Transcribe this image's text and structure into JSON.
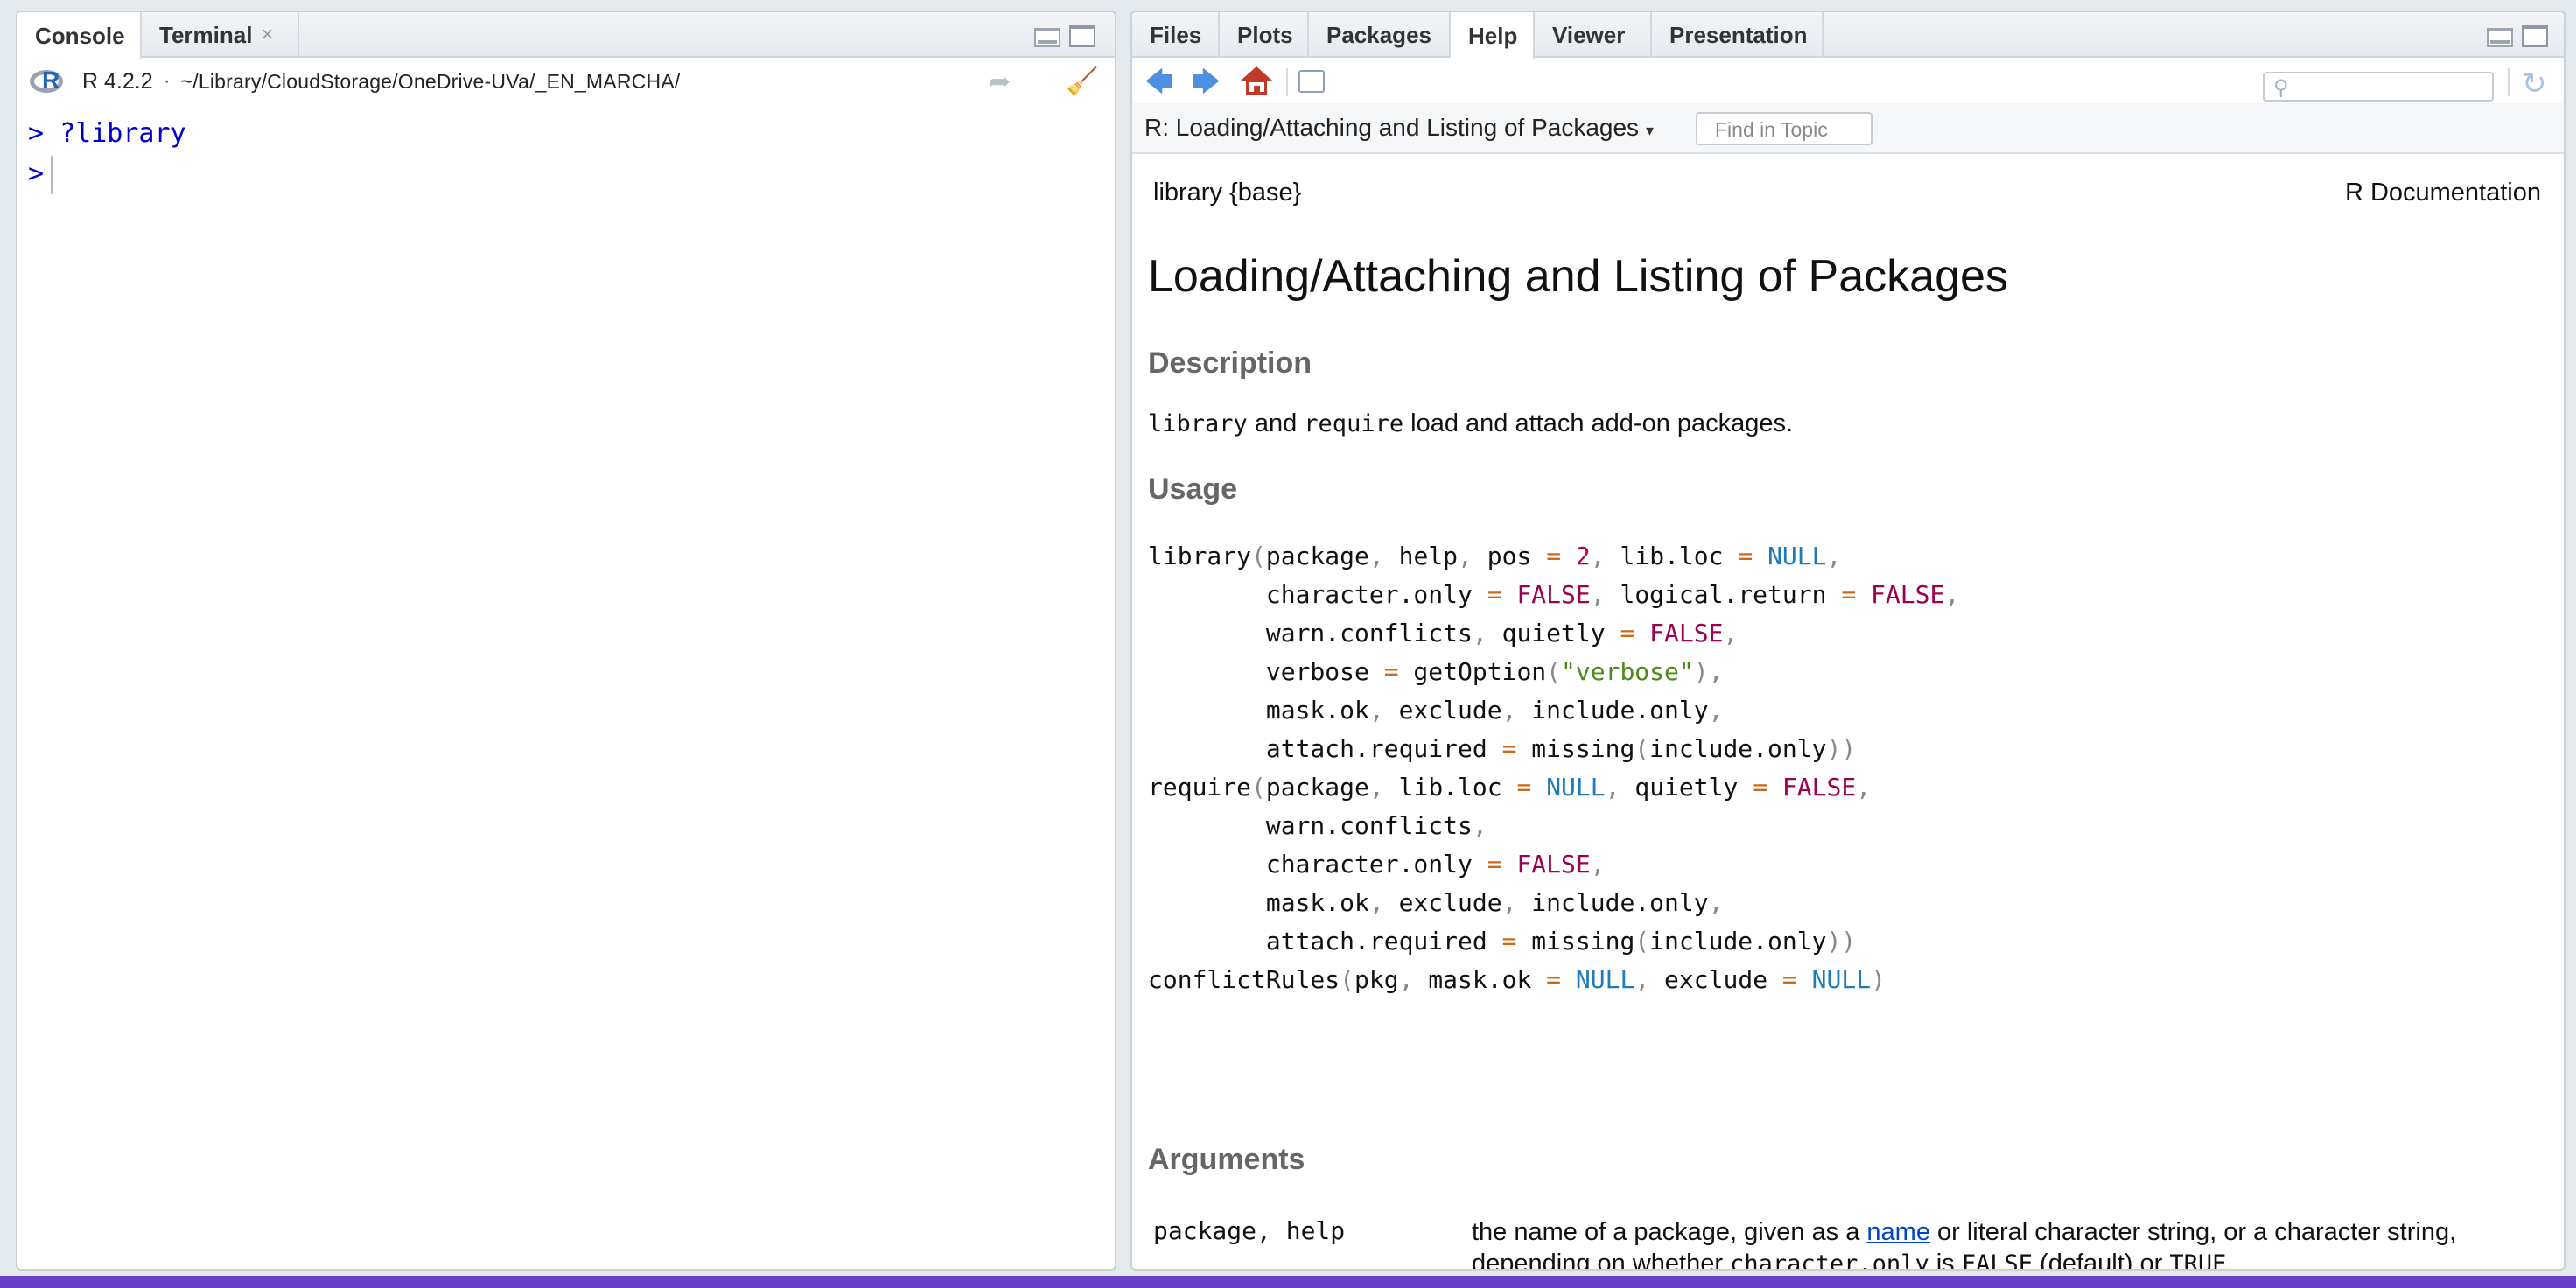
{
  "left_pane": {
    "tabs": [
      {
        "label": "Console"
      },
      {
        "label": "Terminal",
        "close": "×"
      }
    ],
    "toolbar": {
      "version": "R 4.2.2",
      "separator": "·",
      "path": "~/Library/CloudStorage/OneDrive-UVa/_EN_MARCHA/"
    },
    "console_lines": [
      {
        "prompt": ">",
        "text": "?library"
      },
      {
        "prompt": ">",
        "text": ""
      }
    ]
  },
  "right_pane": {
    "tabs": [
      {
        "label": "Files"
      },
      {
        "label": "Plots"
      },
      {
        "label": "Packages"
      },
      {
        "label": "Help"
      },
      {
        "label": "Viewer"
      },
      {
        "label": "Presentation"
      }
    ],
    "active_tab": "Help",
    "topic_title": "R: Loading/Attaching and Listing of Packages",
    "find_placeholder": "Find in Topic",
    "search_placeholder": ""
  },
  "doc": {
    "header_left": "library {base}",
    "header_right": "R Documentation",
    "title": "Loading/Attaching and Listing of Packages",
    "description_heading": "Description",
    "description": {
      "code1": "library",
      "and": " and ",
      "code2": "require",
      "rest": " load and attach add-on packages."
    },
    "usage_heading": "Usage",
    "arguments_heading": "Arguments",
    "arguments": [
      {
        "name": "package, help",
        "desc_before": "the name of a package, given as a ",
        "link": "name",
        "desc_after": " or literal character string, or a character string, depending on whether ",
        "code1": "character.only",
        "is": " is ",
        "code2": "FALSE",
        "tail": " (default) or ",
        "code3": "TRUE",
        "end": "."
      }
    ]
  },
  "colors": {
    "accent_blue": "#0000cc",
    "operator": "#c86a1a",
    "number": "#b8004b",
    "null_kw": "#1f7ab8",
    "string": "#4b8a1a"
  }
}
